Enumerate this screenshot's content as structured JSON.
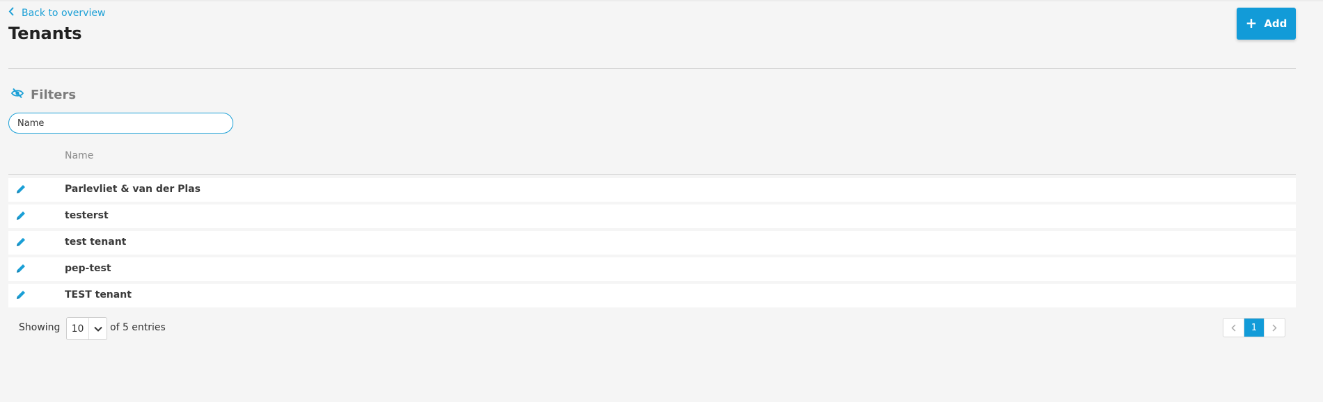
{
  "header": {
    "back_label": "Back to overview",
    "title": "Tenants",
    "add_label": "Add"
  },
  "filters": {
    "title": "Filters",
    "name_placeholder": "Name",
    "name_value": ""
  },
  "table": {
    "columns": [
      "Name"
    ],
    "rows": [
      {
        "name": "Parlevliet & van der Plas"
      },
      {
        "name": "testerst"
      },
      {
        "name": "test tenant"
      },
      {
        "name": "pep-test"
      },
      {
        "name": "TEST tenant"
      }
    ]
  },
  "footer": {
    "showing_label": "Showing",
    "page_size": "10",
    "entries_label": "of 5 entries",
    "current_page": "1"
  },
  "icons": {
    "back": "chevron-left-icon",
    "add": "plus-icon",
    "filters": "eye-off-icon",
    "edit": "pencil-icon",
    "page_size": "chevron-down-icon",
    "prev": "chevron-left-icon",
    "next": "chevron-right-icon"
  },
  "colors": {
    "accent": "#129bd8",
    "background": "#f5f5f5",
    "row_background": "#ffffff"
  }
}
